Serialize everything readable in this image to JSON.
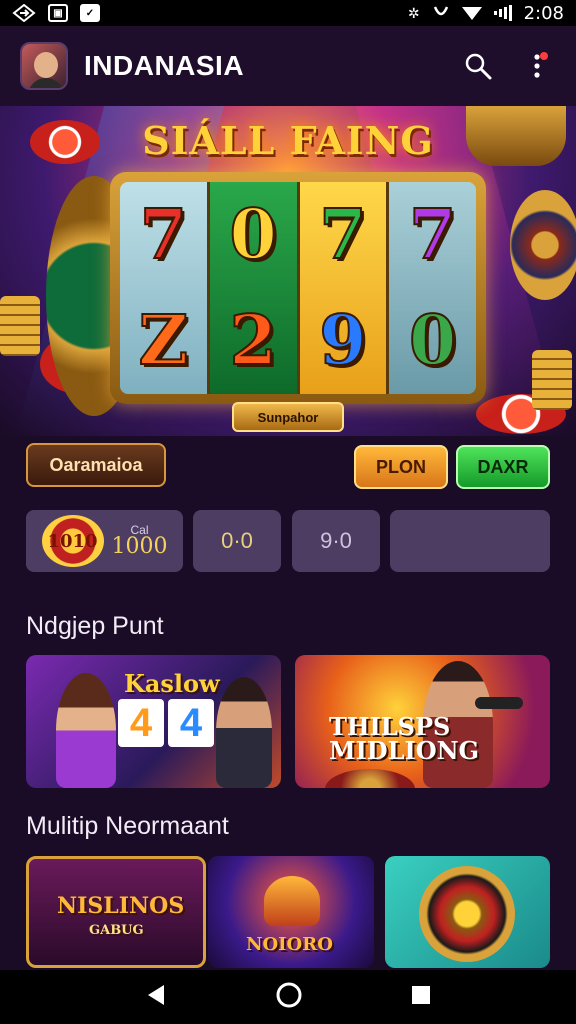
{
  "status_bar": {
    "time": "2:08",
    "icons": [
      "navigation-icon",
      "image-icon",
      "photo-icon",
      "bluetooth-icon",
      "vibrate-icon",
      "wifi-icon",
      "signal-icon"
    ]
  },
  "app_bar": {
    "title": "INDANASIA",
    "icons": [
      "search-icon",
      "more-vertical-icon"
    ],
    "notification_color": "#ff3b3b"
  },
  "hero": {
    "title": "SIÁLL FAING",
    "reel_top": [
      "7",
      "0",
      "7",
      "7"
    ],
    "reel_bottom": [
      "Z",
      "2",
      "9",
      "0"
    ],
    "badge": "Sunpahor"
  },
  "actions": {
    "game_button": "Oaramaioa",
    "plon_button": "PLON",
    "daxr_button": "DAXR"
  },
  "stats": {
    "coin_badge": "1010",
    "cash_label": "Cal",
    "cash_value": "1000",
    "box_2": "0·0",
    "box_3": "9·0",
    "box_4": ""
  },
  "section_1": {
    "title": "Ndgjep Punt",
    "cards": [
      {
        "label": "Kaslow",
        "numbers": [
          "4",
          "4"
        ]
      },
      {
        "label": "THILSPS\nMIDLIONG"
      }
    ]
  },
  "section_2": {
    "title": "Mulitip Neormaant",
    "cards": [
      {
        "label": "NISLINOS",
        "sublabel": "GABUG"
      },
      {
        "label": "NOIORO"
      },
      {
        "label": ""
      }
    ]
  },
  "colors": {
    "background": "#1a0b26",
    "accent_gold": "#ffd23a",
    "plon_orange": "#ffb83a",
    "daxr_green": "#4fe35a"
  },
  "nav_bar": {
    "icons": [
      "back-icon",
      "home-icon",
      "recents-icon"
    ]
  }
}
